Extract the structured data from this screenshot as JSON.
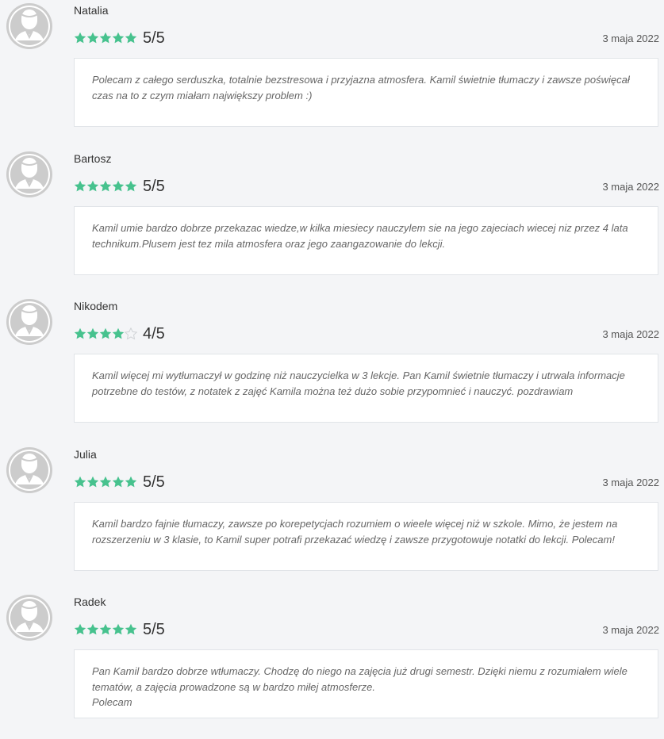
{
  "colors": {
    "star_filled": "#47c28e",
    "star_empty": "#d0d3d6",
    "avatar": "#cccccc"
  },
  "icons": {
    "avatar": "user-avatar-icon",
    "star": "star-icon"
  },
  "reviews": [
    {
      "name": "Natalia",
      "rating": 5,
      "score": "5/5",
      "date": "3 maja 2022",
      "text": "Polecam z całego serduszka, totalnie bezstresowa i przyjazna atmosfera. Kamil świetnie tłumaczy i zawsze poświęcał czas na to z czym miałam największy problem :)"
    },
    {
      "name": "Bartosz",
      "rating": 5,
      "score": "5/5",
      "date": "3 maja 2022",
      "text": "Kamil umie bardzo dobrze przekazac wiedze,w kilka miesiecy nauczylem sie na jego zajeciach wiecej niz przez 4 lata technikum.Plusem jest tez mila atmosfera oraz jego zaangazowanie do lekcji."
    },
    {
      "name": "Nikodem",
      "rating": 4,
      "score": "4/5",
      "date": "3 maja 2022",
      "text": "Kamil więcej mi wytłumaczył w godzinę niż nauczycielka w 3 lekcje. Pan Kamil świetnie tłumaczy i utrwala informacje potrzebne do testów, z notatek z zajęć Kamila można też dużo sobie przypomnieć i nauczyć. pozdrawiam"
    },
    {
      "name": "Julia",
      "rating": 5,
      "score": "5/5",
      "date": "3 maja 2022",
      "text": "Kamil bardzo fajnie tłumaczy, zawsze po korepetycjach rozumiem o wieele więcej niż w szkole. Mimo, że jestem na rozszerzeniu w 3 klasie, to Kamil super potrafi przekazać wiedzę i zawsze przygotowuje notatki do lekcji. Polecam!"
    },
    {
      "name": "Radek",
      "rating": 5,
      "score": "5/5",
      "date": "3 maja 2022",
      "text": "Pan Kamil bardzo dobrze wtłumaczy. Chodzę do niego na zajęcia już drugi semestr. Dzięki niemu z rozumiałem wiele tematów, a zajęcia prowadzone są w bardzo miłej atmosferze.\nPolecam"
    }
  ]
}
